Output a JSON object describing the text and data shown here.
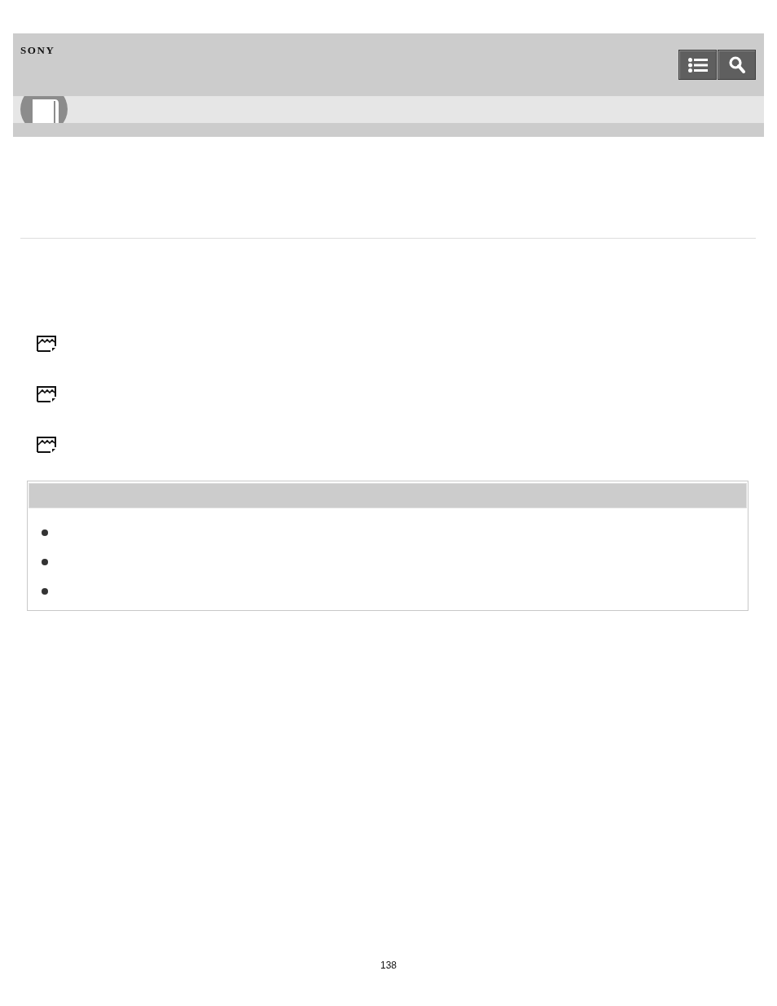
{
  "header": {
    "logo": "SONY"
  },
  "page_number": "138"
}
